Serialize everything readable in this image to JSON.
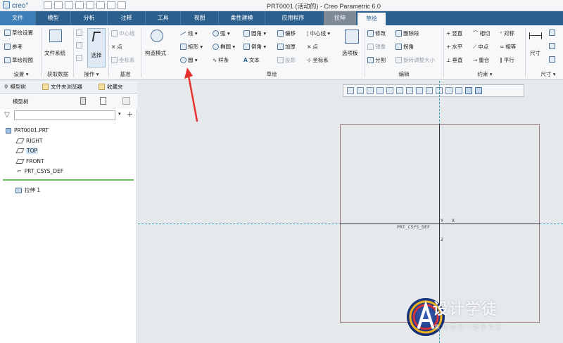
{
  "window": {
    "logo": "creo°",
    "title": "PRT0001 (活动的) - Creo Parametric 6.0"
  },
  "tabs": [
    {
      "label": "文件"
    },
    {
      "label": "模型"
    },
    {
      "label": "分析"
    },
    {
      "label": "注释"
    },
    {
      "label": "工具"
    },
    {
      "label": "视图"
    },
    {
      "label": "柔性建模"
    },
    {
      "label": "应用程序"
    },
    {
      "label": "拉伸"
    },
    {
      "label": "草绘"
    }
  ],
  "ribbon": {
    "setup": {
      "items": [
        "草绘设置",
        "参考",
        "草绘视图"
      ],
      "group": "设置 ▾"
    },
    "get_data": {
      "file_system": "文件系统",
      "group": "获取数据"
    },
    "operations": {
      "select": "选择",
      "group": "操作 ▾"
    },
    "datum": {
      "items": [
        "中心线",
        "点",
        "坐标系"
      ],
      "group": "基准"
    },
    "construction_mode": "构造模式",
    "sketch": {
      "col1": [
        "线 ▾",
        "矩形 ▾",
        "圆 ▾"
      ],
      "col2": [
        "弧 ▾",
        "椭圆 ▾",
        "样条"
      ],
      "col3": [
        "圆角 ▾",
        "倒角 ▾",
        "文本"
      ],
      "col4": [
        "偏移",
        "加厚",
        "投影"
      ],
      "col5": [
        "中心线 ▾",
        "点",
        "坐标系"
      ],
      "palette": "选项板",
      "group": "草绘"
    },
    "edit": {
      "items": [
        "修改",
        "删除段",
        "镜像",
        "拐角",
        "分割",
        "旋转调整大小"
      ],
      "group": "编辑"
    },
    "constrain": {
      "items": [
        "竖直",
        "相切",
        "对称",
        "水平",
        "中点",
        "相等",
        "垂直",
        "重合",
        "平行"
      ],
      "group": "约束 ▾"
    },
    "dimension": {
      "label": "尺寸",
      "group": "尺寸 ▾"
    }
  },
  "left_tabs": [
    "模型树",
    "文件夹浏览器",
    "收藏夹"
  ],
  "model_tree": {
    "title": "模型树",
    "filter_placeholder": "",
    "items": [
      "PRT0001.PRT",
      "RIGHT",
      "TOP",
      "FRONT",
      "PRT_CSYS_DEF",
      "拉伸 1"
    ],
    "selected": "TOP"
  },
  "canvas": {
    "csys_label": "PRT_CSYS_DEF",
    "axis_x": "X",
    "axis_y": "Y",
    "axis_z": "Z"
  },
  "watermark": {
    "title": "设计学徒",
    "subtitle": "来和我们一起学设计"
  },
  "colors": {
    "tab_bar": "#2b5f8e",
    "file_tab": "#3f7fb8",
    "annotation_arrow": "#e5322d",
    "sketch_rect": "#a07a7a",
    "reference_lines": "#3f9fb0"
  },
  "icons": [
    "search-icon",
    "filter-icon",
    "zoom-in-icon",
    "zoom-out-icon",
    "refit-icon",
    "circle-icon",
    "line-icon",
    "rectangle-icon"
  ]
}
